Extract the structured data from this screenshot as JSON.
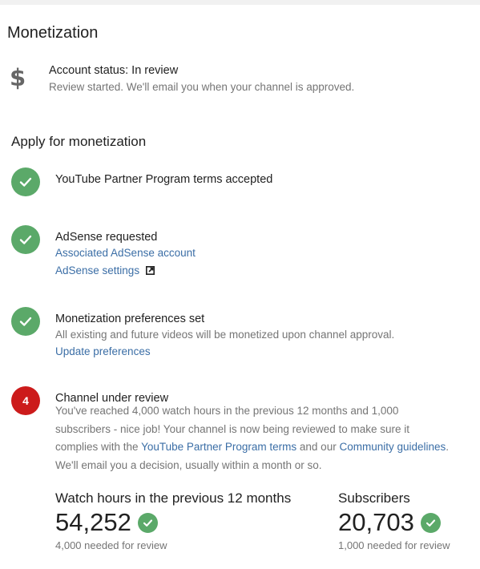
{
  "page": {
    "title": "Monetization"
  },
  "account_status": {
    "icon": "dollar-icon",
    "icon_glyph": "$",
    "title": "Account status: In review",
    "subtitle": "Review started. We'll email you when your channel is approved."
  },
  "apply": {
    "title": "Apply for monetization",
    "steps": [
      {
        "status": "complete",
        "title": "YouTube Partner Program terms accepted"
      },
      {
        "status": "complete",
        "title": "AdSense requested",
        "link1": "Associated AdSense account",
        "link2": "AdSense settings",
        "link2_icon": "external-link-icon"
      },
      {
        "status": "complete",
        "title": "Monetization preferences set",
        "text": "All existing and future videos will be monetized upon channel approval.",
        "link": "Update preferences"
      },
      {
        "status": "current",
        "number": "4",
        "title": "Channel under review",
        "line1": "You've reached 4,000 watch hours in the previous 12 months and 1,000",
        "line2": "subscribers - nice job! Your channel is now being reviewed to make sure it",
        "line3_prefix": "complies with the ",
        "line3_link1": "YouTube Partner Program terms",
        "line3_mid": " and our ",
        "line3_link2": "Community guidelines",
        "line3_suffix": ".",
        "line4": "We'll email you a decision, usually within a month or so."
      }
    ]
  },
  "stats": {
    "watch_hours": {
      "label": "Watch hours in the previous 12 months",
      "value": "54,252",
      "requirement": "4,000 needed for review"
    },
    "subscribers": {
      "label": "Subscribers",
      "value": "20,703",
      "requirement": "1,000 needed for review"
    }
  },
  "colors": {
    "success": "#5ba969",
    "current": "#cc1b1b",
    "link": "#3b6ea6"
  }
}
